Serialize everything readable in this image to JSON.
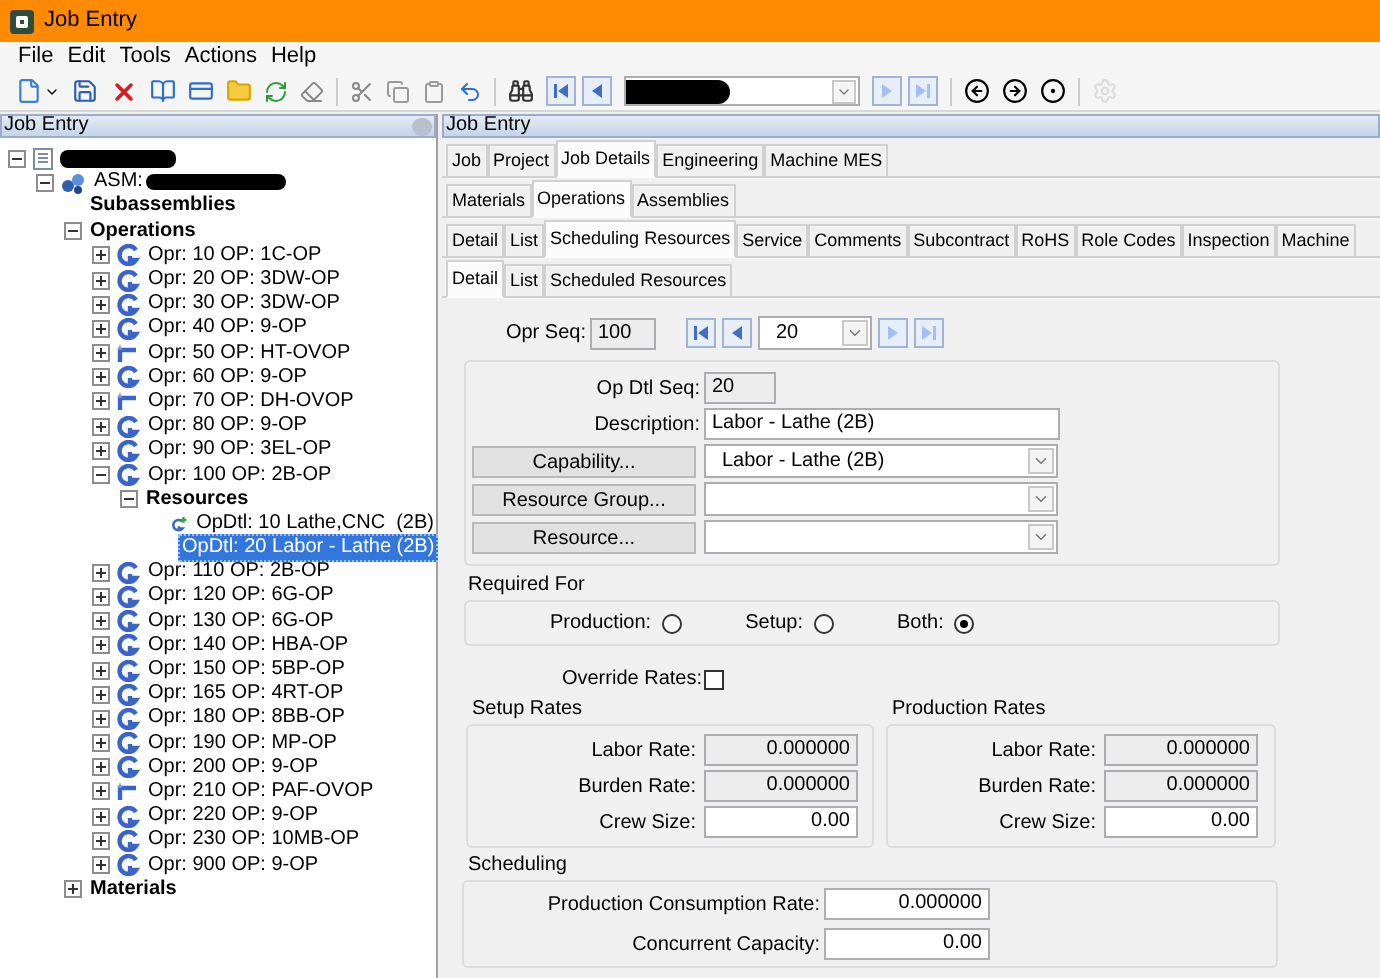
{
  "window": {
    "title": "Job Entry"
  },
  "menu": [
    "File",
    "Edit",
    "Tools",
    "Actions",
    "Help"
  ],
  "left_panel": {
    "title": "Job Entry",
    "tree": [
      {
        "kind": "job",
        "expanded": true,
        "selected": false,
        "children": [
          {
            "kind": "assembly",
            "label": "ASM:",
            "expanded": true,
            "selected": false,
            "children": [
              {
                "kind": "group",
                "label": "Subassemblies",
                "selected": false
              },
              {
                "kind": "group",
                "label": "Operations",
                "expanded": true,
                "selected": false,
                "children": [
                  {
                    "kind": "operation",
                    "label": "Opr: 10 OP: 1C-OP",
                    "expanded": false,
                    "selected": false
                  },
                  {
                    "kind": "operation",
                    "label": "Opr: 20 OP: 3DW-OP",
                    "expanded": false,
                    "selected": false
                  },
                  {
                    "kind": "operation",
                    "label": "Opr: 30 OP: 3DW-OP",
                    "expanded": false,
                    "selected": false
                  },
                  {
                    "kind": "operation",
                    "label": "Opr: 40 OP: 9-OP",
                    "expanded": false,
                    "selected": false
                  },
                  {
                    "kind": "subcontract",
                    "label": "Opr: 50 OP: HT-OVOP",
                    "expanded": false,
                    "selected": false
                  },
                  {
                    "kind": "operation",
                    "label": "Opr: 60 OP: 9-OP",
                    "expanded": false,
                    "selected": false
                  },
                  {
                    "kind": "subcontract",
                    "label": "Opr: 70 OP: DH-OVOP",
                    "expanded": false,
                    "selected": false
                  },
                  {
                    "kind": "operation",
                    "label": "Opr: 80 OP: 9-OP",
                    "expanded": false,
                    "selected": false
                  },
                  {
                    "kind": "operation",
                    "label": "Opr: 90 OP: 3EL-OP",
                    "expanded": false,
                    "selected": false
                  },
                  {
                    "kind": "operation",
                    "label": "Opr: 100 OP: 2B-OP",
                    "expanded": true,
                    "selected": false,
                    "children": [
                      {
                        "kind": "group",
                        "label": "Resources",
                        "expanded": true,
                        "selected": false,
                        "children": [
                          {
                            "kind": "detail",
                            "label": "OpDtl: 10 Lathe,CNC  (2B)",
                            "selected": false
                          },
                          {
                            "kind": "detail",
                            "label": "OpDtl: 20 Labor - Lathe (2B)",
                            "selected": true
                          }
                        ]
                      }
                    ]
                  },
                  {
                    "kind": "operation",
                    "label": "Opr: 110 OP: 2B-OP",
                    "expanded": false,
                    "selected": false
                  },
                  {
                    "kind": "operation",
                    "label": "Opr: 120 OP: 6G-OP",
                    "expanded": false,
                    "selected": false
                  },
                  {
                    "kind": "operation",
                    "label": "Opr: 130 OP: 6G-OP",
                    "expanded": false,
                    "selected": false
                  },
                  {
                    "kind": "operation",
                    "label": "Opr: 140 OP: HBA-OP",
                    "expanded": false,
                    "selected": false
                  },
                  {
                    "kind": "operation",
                    "label": "Opr: 150 OP: 5BP-OP",
                    "expanded": false,
                    "selected": false
                  },
                  {
                    "kind": "operation",
                    "label": "Opr: 165 OP: 4RT-OP",
                    "expanded": false,
                    "selected": false
                  },
                  {
                    "kind": "operation",
                    "label": "Opr: 180 OP: 8BB-OP",
                    "expanded": false,
                    "selected": false
                  },
                  {
                    "kind": "operation",
                    "label": "Opr: 190 OP: MP-OP",
                    "expanded": false,
                    "selected": false
                  },
                  {
                    "kind": "operation",
                    "label": "Opr: 200 OP: 9-OP",
                    "expanded": false,
                    "selected": false
                  },
                  {
                    "kind": "subcontract",
                    "label": "Opr: 210 OP: PAF-OVOP",
                    "expanded": false,
                    "selected": false
                  },
                  {
                    "kind": "operation",
                    "label": "Opr: 220 OP: 9-OP",
                    "expanded": false,
                    "selected": false
                  },
                  {
                    "kind": "operation",
                    "label": "Opr: 230 OP: 10MB-OP",
                    "expanded": false,
                    "selected": false
                  },
                  {
                    "kind": "operation",
                    "label": "Opr: 900 OP: 9-OP",
                    "expanded": false,
                    "selected": false
                  }
                ]
              },
              {
                "kind": "group",
                "label": "Materials",
                "expanded": false,
                "selected": false
              }
            ]
          }
        ]
      }
    ]
  },
  "right_panel": {
    "title": "Job Entry",
    "tab_rows": [
      [
        {
          "label": "Job",
          "selected": false
        },
        {
          "label": "Project",
          "selected": false
        },
        {
          "label": "Job Details",
          "selected": true
        },
        {
          "label": "Engineering",
          "selected": false
        },
        {
          "label": "Machine MES",
          "selected": false
        }
      ],
      [
        {
          "label": "Materials",
          "selected": false
        },
        {
          "label": "Operations",
          "selected": true
        },
        {
          "label": "Assemblies",
          "selected": false
        }
      ],
      [
        {
          "label": "Detail",
          "selected": false
        },
        {
          "label": "List",
          "selected": false
        },
        {
          "label": "Scheduling Resources",
          "selected": true
        },
        {
          "label": "Service",
          "selected": false
        },
        {
          "label": "Comments",
          "selected": false
        },
        {
          "label": "Subcontract",
          "selected": false
        },
        {
          "label": "RoHS",
          "selected": false
        },
        {
          "label": "Role Codes",
          "selected": false
        },
        {
          "label": "Inspection",
          "selected": false
        },
        {
          "label": "Machine",
          "selected": false
        }
      ],
      [
        {
          "label": "Detail",
          "selected": true
        },
        {
          "label": "List",
          "selected": false
        },
        {
          "label": "Scheduled Resources",
          "selected": false
        }
      ]
    ],
    "opr_seq": {
      "label": "Opr Seq:",
      "value": "100"
    },
    "nav_combo": {
      "value": "20"
    },
    "op_dtl_seq": {
      "label": "Op Dtl Seq:",
      "value": "20"
    },
    "description": {
      "label": "Description:",
      "value": "Labor - Lathe (2B)"
    },
    "lookups": [
      {
        "button": "Capability...",
        "value": "Labor - Lathe (2B)"
      },
      {
        "button": "Resource Group..."
      },
      {
        "button": "Resource..."
      }
    ],
    "required_for": {
      "title": "Required For",
      "options": [
        {
          "label": "Production:",
          "selected": false
        },
        {
          "label": "Setup:",
          "selected": false
        },
        {
          "label": "Both:",
          "selected": true
        }
      ]
    },
    "override_rates": {
      "label": "Override Rates:",
      "checked": false
    },
    "rate_groups": [
      {
        "title": "Setup Rates",
        "fields": [
          {
            "label": "Labor Rate:",
            "value": "0.000000",
            "disabled": true
          },
          {
            "label": "Burden Rate:",
            "value": "0.000000",
            "disabled": true
          },
          {
            "label": "Crew Size:",
            "value": "0.00",
            "disabled": false
          }
        ]
      },
      {
        "title": "Production Rates",
        "fields": [
          {
            "label": "Labor Rate:",
            "value": "0.000000",
            "disabled": true
          },
          {
            "label": "Burden Rate:",
            "value": "0.000000",
            "disabled": true
          },
          {
            "label": "Crew Size:",
            "value": "0.00",
            "disabled": false
          }
        ]
      }
    ],
    "scheduling": {
      "title": "Scheduling",
      "fields": [
        {
          "label": "Production Consumption Rate:",
          "value": "0.000000",
          "disabled": false
        },
        {
          "label": "Concurrent Capacity:",
          "value": "0.00",
          "disabled": false
        }
      ]
    }
  }
}
